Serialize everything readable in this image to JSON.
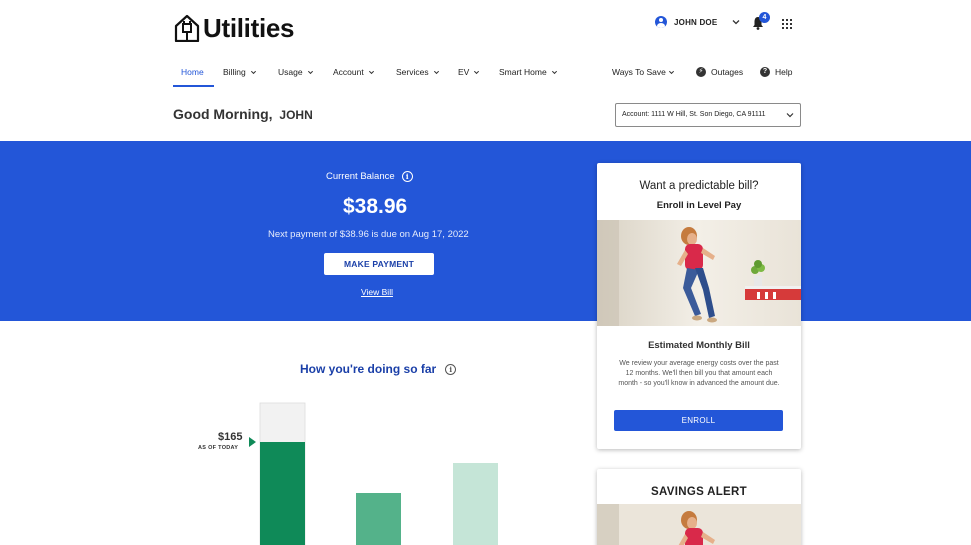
{
  "brand": {
    "logo_text": "Utilities",
    "accent": "#2356d8",
    "dark_green": "#0f8a58"
  },
  "header": {
    "user_name": "JOHN DOE",
    "notifications_count": "4"
  },
  "nav": {
    "items": [
      {
        "label": "Home",
        "active": true
      },
      {
        "label": "Billing"
      },
      {
        "label": "Usage"
      },
      {
        "label": "Account"
      },
      {
        "label": "Services"
      },
      {
        "label": "EV"
      },
      {
        "label": "Smart Home"
      }
    ],
    "right": [
      {
        "label": "Ways To Save"
      },
      {
        "label": "Outages"
      },
      {
        "label": "Help"
      }
    ]
  },
  "greeting": {
    "text": "Good Morning,",
    "name": "JOHN"
  },
  "account_selector": {
    "label": "Account:  1111 W Hill, St. Son Diego, CA 91111"
  },
  "balance": {
    "label": "Current Balance",
    "amount": "$38.96",
    "next_payment": "Next payment of $38.96 is due on Aug 17, 2022",
    "make_payment_label": "MAKE PAYMENT",
    "view_bill_label": "View Bill"
  },
  "doing_so_far": {
    "title": "How you're doing so far",
    "amount_label": "$165",
    "as_of_label": "AS OF TODAY"
  },
  "level_pay_card": {
    "title": "Want a predictable bill?",
    "subtitle": "Enroll in Level Pay",
    "section_title": "Estimated Monthly Bill",
    "description": "We review your average energy costs over the past 12 months. We'll then bill you that amount each month - so you'll know in advanced the amount due.",
    "button_label": "ENROLL"
  },
  "savings_card": {
    "title": "SAVINGS ALERT"
  }
}
